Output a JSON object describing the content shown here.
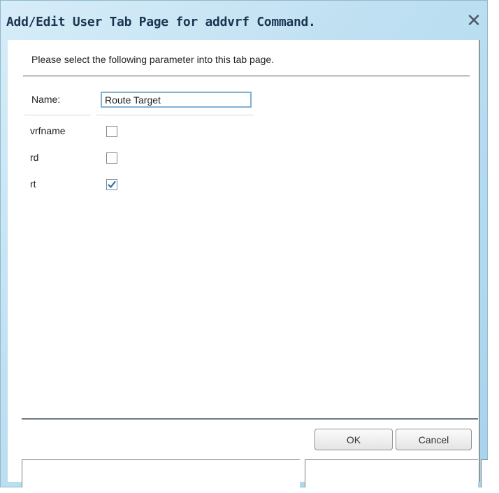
{
  "window": {
    "title": "Add/Edit User Tab Page for addvrf Command.",
    "close_icon": "close-icon"
  },
  "instruction": "Please select the following parameter into this tab page.",
  "name_field": {
    "label": "Name:",
    "value": "Route Target"
  },
  "parameters": [
    {
      "label": "vrfname",
      "checked": false
    },
    {
      "label": "rd",
      "checked": false
    },
    {
      "label": "rt",
      "checked": true
    }
  ],
  "buttons": {
    "ok": "OK",
    "cancel": "Cancel"
  },
  "figure_id": "281799",
  "colors": {
    "title_text": "#1b3550",
    "window_frame": "#bfe0f2",
    "check_mark": "#2e6da4",
    "input_border": "#7fb1d4"
  }
}
